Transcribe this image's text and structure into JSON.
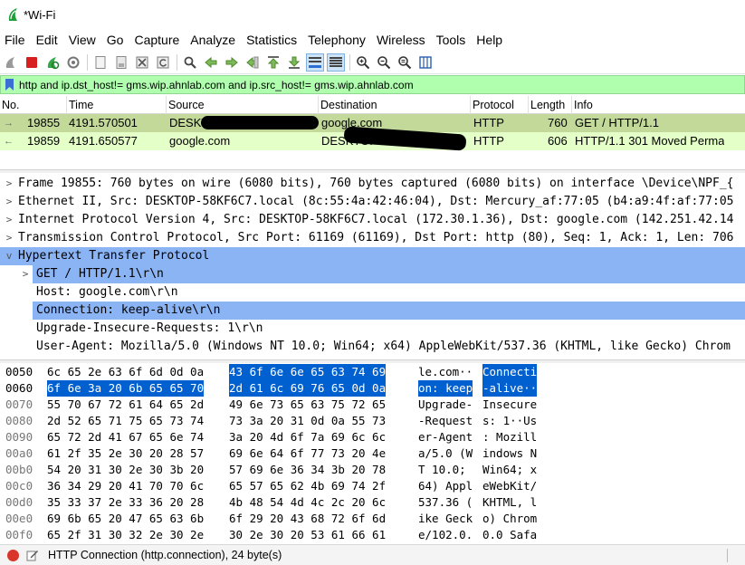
{
  "window": {
    "title": "*Wi-Fi"
  },
  "menu": [
    "File",
    "Edit",
    "View",
    "Go",
    "Capture",
    "Analyze",
    "Statistics",
    "Telephony",
    "Wireless",
    "Tools",
    "Help"
  ],
  "toolbar_icons": [
    "shark-fin-start-icon",
    "stop-capture-icon",
    "restart-capture-icon",
    "capture-options-icon",
    "open-file-icon",
    "save-file-icon",
    "close-file-icon",
    "reload-file-icon",
    "find-packet-icon",
    "go-back-icon",
    "go-forward-icon",
    "go-to-packet-icon",
    "first-packet-icon",
    "last-packet-icon",
    "autoscroll-icon",
    "colorize-icon",
    "zoom-in-icon",
    "zoom-out-icon",
    "normal-size-icon",
    "resize-columns-icon"
  ],
  "filter": {
    "text": "http and ip.dst_host!= gms.wip.ahnlab.com and ip.src_host!= gms.wip.ahnlab.com"
  },
  "packet_list": {
    "columns": [
      "No.",
      "Time",
      "Source",
      "Destination",
      "Protocol",
      "Length",
      "Info"
    ],
    "rows": [
      {
        "no": "19855",
        "time": "4191.570501",
        "source": "DESKTOP-58KF6C7.l",
        "destination": "google.com",
        "protocol": "HTTP",
        "length": "760",
        "info": "GET / HTTP/1.1"
      },
      {
        "no": "19859",
        "time": "4191.650577",
        "source": "google.com",
        "destination": "DESKTOP-58KF6C7.l",
        "protocol": "HTTP",
        "length": "606",
        "info": "HTTP/1.1 301 Moved Perma"
      }
    ]
  },
  "details": [
    {
      "text": "Frame 19855: 760 bytes on wire (6080 bits), 760 bytes captured (6080 bits) on interface \\Device\\NPF_{",
      "arrow": ">"
    },
    {
      "text": "Ethernet II, Src: DESKTOP-58KF6C7.local (8c:55:4a:42:46:04), Dst: Mercury_af:77:05 (b4:a9:4f:af:77:05",
      "arrow": ">"
    },
    {
      "text": "Internet Protocol Version 4, Src: DESKTOP-58KF6C7.local (172.30.1.36), Dst: google.com (142.251.42.14",
      "arrow": ">"
    },
    {
      "text": "Transmission Control Protocol, Src Port: 61169 (61169), Dst Port: http (80), Seq: 1, Ack: 1, Len: 706",
      "arrow": ">"
    },
    {
      "text": "Hypertext Transfer Protocol",
      "arrow": "v"
    },
    {
      "text": "GET / HTTP/1.1\\r\\n",
      "arrow": ">"
    },
    {
      "text": "Host: google.com\\r\\n",
      "arrow": ""
    },
    {
      "text": "Connection: keep-alive\\r\\n",
      "arrow": ""
    },
    {
      "text": "Upgrade-Insecure-Requests: 1\\r\\n",
      "arrow": ""
    },
    {
      "text": "User-Agent: Mozilla/5.0 (Windows NT 10.0; Win64; x64) AppleWebKit/537.36 (KHTML, like Gecko) Chrom",
      "arrow": ""
    }
  ],
  "bytes": [
    {
      "offset": "0050",
      "hex_a": "6c 65 2e 63 6f 6d 0d 0a",
      "hex_b": "43 6f 6e 6e 65 63 74 69",
      "asc_a": "le.com··",
      "asc_b": "Connecti"
    },
    {
      "offset": "0060",
      "hex_a": "6f 6e 3a 20 6b 65 65 70",
      "hex_b": "2d 61 6c 69 76 65 0d 0a",
      "asc_a": "on: keep",
      "asc_b": "-alive··"
    },
    {
      "offset": "0070",
      "hex_a": "55 70 67 72 61 64 65 2d",
      "hex_b": "49 6e 73 65 63 75 72 65",
      "asc_a": "Upgrade-",
      "asc_b": "Insecure"
    },
    {
      "offset": "0080",
      "hex_a": "2d 52 65 71 75 65 73 74",
      "hex_b": "73 3a 20 31 0d 0a 55 73",
      "asc_a": "-Request",
      "asc_b": "s: 1··Us"
    },
    {
      "offset": "0090",
      "hex_a": "65 72 2d 41 67 65 6e 74",
      "hex_b": "3a 20 4d 6f 7a 69 6c 6c",
      "asc_a": "er-Agent",
      "asc_b": ": Mozill"
    },
    {
      "offset": "00a0",
      "hex_a": "61 2f 35 2e 30 20 28 57",
      "hex_b": "69 6e 64 6f 77 73 20 4e",
      "asc_a": "a/5.0 (W",
      "asc_b": "indows N"
    },
    {
      "offset": "00b0",
      "hex_a": "54 20 31 30 2e 30 3b 20",
      "hex_b": "57 69 6e 36 34 3b 20 78",
      "asc_a": "T 10.0; ",
      "asc_b": "Win64; x"
    },
    {
      "offset": "00c0",
      "hex_a": "36 34 29 20 41 70 70 6c",
      "hex_b": "65 57 65 62 4b 69 74 2f",
      "asc_a": "64) Appl",
      "asc_b": "eWebKit/"
    },
    {
      "offset": "00d0",
      "hex_a": "35 33 37 2e 33 36 20 28",
      "hex_b": "4b 48 54 4d 4c 2c 20 6c",
      "asc_a": "537.36 (",
      "asc_b": "KHTML, l"
    },
    {
      "offset": "00e0",
      "hex_a": "69 6b 65 20 47 65 63 6b",
      "hex_b": "6f 29 20 43 68 72 6f 6d",
      "asc_a": "ike Geck",
      "asc_b": "o) Chrom"
    },
    {
      "offset": "00f0",
      "hex_a": "65 2f 31 30 32 2e 30 2e",
      "hex_b": "30 2e 30 20 53 61 66 61",
      "asc_a": "e/102.0.",
      "asc_b": "0.0 Safa"
    }
  ],
  "status": {
    "text": "HTTP Connection (http.connection), 24 byte(s)"
  },
  "colors": {
    "filter_bg": "#afffaf",
    "row_selected": "#c2d99a",
    "row_http": "#e4ffc7",
    "detail_highlight": "#8bb4f5",
    "byte_selection": "#0060d0"
  }
}
